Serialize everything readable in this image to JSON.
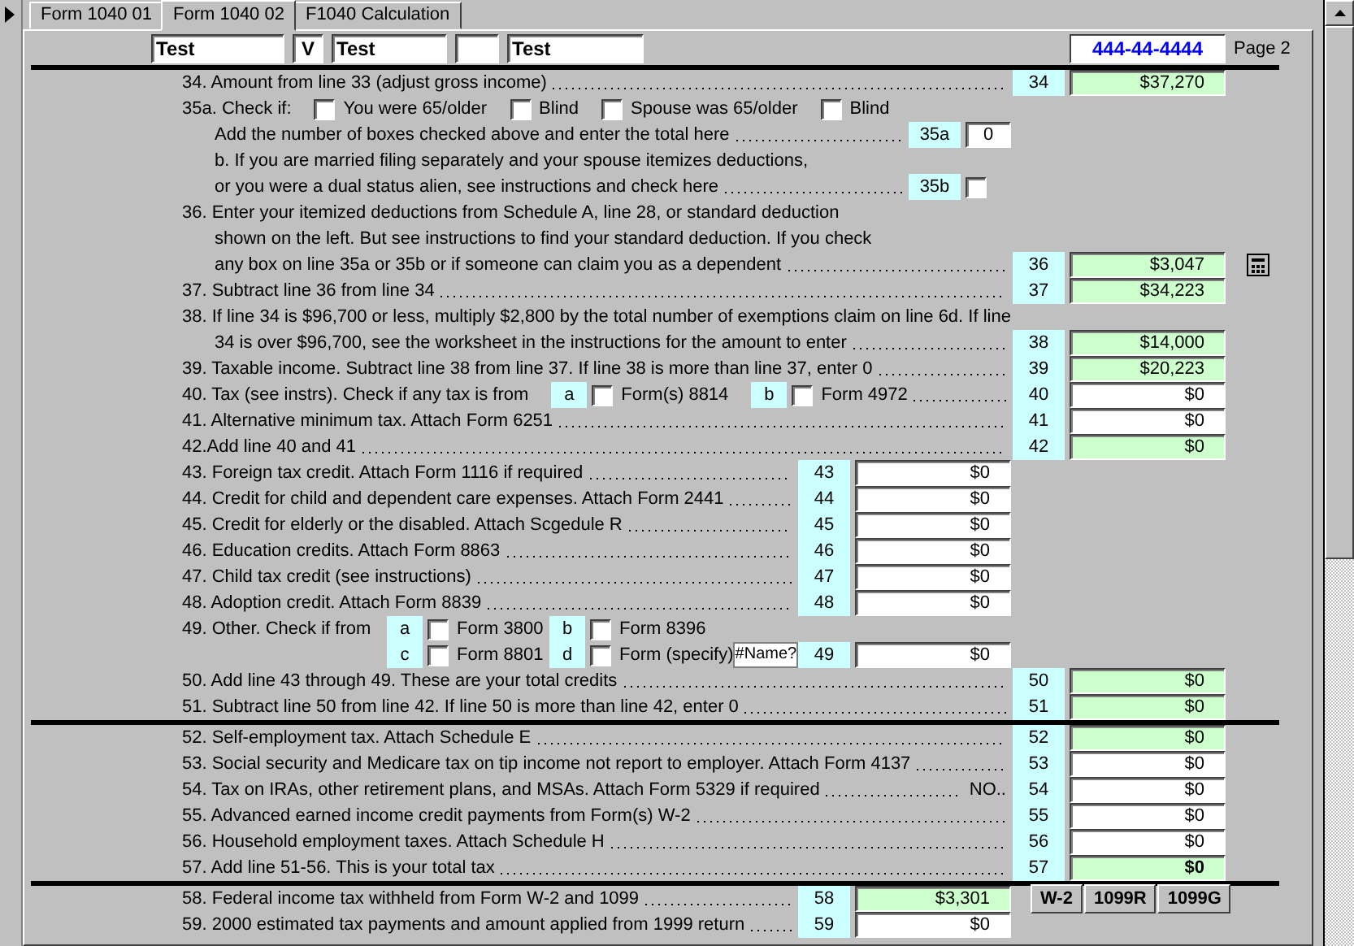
{
  "tabs": [
    {
      "label": "Form 1040 01",
      "selected": false
    },
    {
      "label": "Form 1040 02",
      "selected": true
    },
    {
      "label": "F1040 Calculation",
      "selected": false
    }
  ],
  "header": {
    "fields": [
      {
        "value": "Test"
      },
      {
        "value": "V"
      },
      {
        "value": "Test"
      },
      {
        "kind": "blank"
      },
      {
        "value": "Test"
      }
    ],
    "ssn": "444-44-4444",
    "page": "Page 2"
  },
  "sections": [
    {
      "rows": [
        {
          "kind": "line",
          "text": "34. Amount from line 33 (adjust gross income)",
          "leader": true,
          "entry": {
            "kind": "amount",
            "line": "34",
            "value": "$37,270",
            "computed": true
          }
        },
        {
          "kind": "line",
          "text": "35a. Check if:",
          "checks": [
            {
              "label": "You were 65/older",
              "checked": false
            },
            {
              "label": "Blind",
              "checked": false
            },
            {
              "label": "Spouse was 65/older",
              "checked": false
            },
            {
              "label": "Blind",
              "checked": false
            }
          ],
          "children": [
            {
              "kind": "line",
              "text": "Add the number of boxes checked above and enter the total here",
              "leader": true,
              "entry": {
                "kind": "count",
                "line": "35a",
                "value": "0"
              }
            },
            {
              "kind": "line",
              "text": "b. If you are married filing separately and your spouse itemizes deductions,"
            },
            {
              "kind": "line",
              "text": "or you were a dual status alien, see instructions and check here",
              "leader": true,
              "entry": {
                "kind": "checkbox",
                "line": "35b",
                "checked": false
              }
            }
          ]
        },
        {
          "kind": "line",
          "text": "36. Enter your itemized deductions from Schedule A, line 28, or standard deduction",
          "children": [
            {
              "kind": "line",
              "text": "shown on the left. But see instructions to find your standard deduction. If you check"
            },
            {
              "kind": "line",
              "text": "any box on line 35a or 35b  or if someone can claim you as a dependent",
              "leader": true,
              "calculator": true,
              "entry": {
                "kind": "amount",
                "line": "36",
                "value": "$3,047",
                "computed": true
              }
            }
          ]
        },
        {
          "kind": "line",
          "text": "37. Subtract line 36 from line 34",
          "leader": true,
          "entry": {
            "kind": "amount",
            "line": "37",
            "value": "$34,223",
            "computed": true
          }
        },
        {
          "kind": "line",
          "text": "38. If line 34 is $96,700 or less, multiply $2,800 by the total number of exemptions claim on line 6d. If line",
          "children": [
            {
              "kind": "line",
              "text": "34 is over $96,700, see the worksheet in the instructions for the amount to enter",
              "leader": true,
              "entry": {
                "kind": "amount",
                "line": "38",
                "value": "$14,000",
                "computed": true
              }
            }
          ]
        },
        {
          "kind": "line",
          "text": "39. Taxable income. Subtract line 38 from line 37. If line 38 is more than line 37, enter 0",
          "leader": true,
          "entry": {
            "kind": "amount",
            "line": "39",
            "value": "$20,223",
            "computed": true
          }
        },
        {
          "kind": "line",
          "text": "40. Tax (see instrs). Check if any tax is from",
          "checks": [
            {
              "tag": "a",
              "label": "Form(s) 8814",
              "checked": false
            },
            {
              "tag": "b",
              "label": "Form 4972",
              "checked": false
            }
          ],
          "leader": true,
          "entry": {
            "kind": "amount",
            "line": "40",
            "value": "$0",
            "computed": false
          }
        },
        {
          "kind": "line",
          "text": "41. Alternative minimum tax. Attach Form 6251",
          "leader": true,
          "entry": {
            "kind": "amount",
            "line": "41",
            "value": "$0",
            "computed": false
          }
        },
        {
          "kind": "line",
          "text": "42.Add line 40 and 41",
          "leader": true,
          "entry": {
            "kind": "amount",
            "line": "42",
            "value": "$0",
            "computed": true
          }
        },
        {
          "kind": "line",
          "text": "43. Foreign tax credit. Attach Form 1116 if required",
          "leader": true,
          "entry": {
            "kind": "subamount",
            "line": "43",
            "value": "$0",
            "computed": false
          }
        },
        {
          "kind": "line",
          "text": "44. Credit for child and dependent care expenses. Attach Form 2441",
          "leader": true,
          "entry": {
            "kind": "subamount",
            "line": "44",
            "value": "$0",
            "computed": false
          }
        },
        {
          "kind": "line",
          "text": "45. Credit for elderly or the disabled. Attach Scgedule R",
          "leader": true,
          "entry": {
            "kind": "subamount",
            "line": "45",
            "value": "$0",
            "computed": false
          }
        },
        {
          "kind": "line",
          "text": "46. Education credits. Attach Form 8863",
          "leader": true,
          "entry": {
            "kind": "subamount",
            "line": "46",
            "value": "$0",
            "computed": false
          }
        },
        {
          "kind": "line",
          "text": "47. Child tax credit (see instructions)",
          "leader": true,
          "entry": {
            "kind": "subamount",
            "line": "47",
            "value": "$0",
            "computed": false
          }
        },
        {
          "kind": "line",
          "text": "48. Adoption credit. Attach Form 8839",
          "leader": true,
          "entry": {
            "kind": "subamount",
            "line": "48",
            "value": "$0",
            "computed": false
          }
        },
        {
          "kind": "grid",
          "text": "49. Other. Check if from",
          "checks": [
            {
              "tag": "a",
              "label": "Form 3800",
              "checked": false
            },
            {
              "tag": "b",
              "label": "Form 8396",
              "checked": false
            }
          ]
        },
        {
          "kind": "grid",
          "checks": [
            {
              "tag": "c",
              "label": "Form 8801",
              "checked": false
            },
            {
              "tag": "d",
              "label": "Form (specify)",
              "checked": false
            }
          ],
          "specify": "#Name?",
          "entry": {
            "kind": "subamount",
            "line": "49",
            "value": "$0",
            "computed": false
          }
        },
        {
          "kind": "line",
          "text": "50. Add line 43 through 49. These are your total credits",
          "leader": true,
          "entry": {
            "kind": "amount",
            "line": "50",
            "value": "$0",
            "computed": true
          }
        },
        {
          "kind": "line",
          "text": "51. Subtract line 50 from line 42. If line 50 is more than line 42, enter 0",
          "leader": true,
          "entry": {
            "kind": "amount",
            "line": "51",
            "value": "$0",
            "computed": true
          }
        }
      ]
    },
    {
      "rows": [
        {
          "kind": "line",
          "text": "52. Self-employment tax. Attach Schedule E",
          "leader": true,
          "entry": {
            "kind": "amount",
            "line": "52",
            "value": "$0",
            "computed": true
          }
        },
        {
          "kind": "line",
          "text": "53. Social security and Medicare tax on tip income not report to employer. Attach Form 4137",
          "leader": true,
          "entry": {
            "kind": "amount",
            "line": "53",
            "value": "$0",
            "computed": false
          }
        },
        {
          "kind": "line",
          "text": "54. Tax on IRAs, other retirement plans, and MSAs. Attach Form 5329 if required",
          "leader": true,
          "suffix": "NO..",
          "entry": {
            "kind": "amount",
            "line": "54",
            "value": "$0",
            "computed": false
          }
        },
        {
          "kind": "line",
          "text": "55. Advanced earned income credit payments from Form(s) W-2",
          "leader": true,
          "entry": {
            "kind": "amount",
            "line": "55",
            "value": "$0",
            "computed": false
          }
        },
        {
          "kind": "line",
          "text": "56. Household employment taxes. Attach Schedule H",
          "leader": true,
          "entry": {
            "kind": "amount",
            "line": "56",
            "value": "$0",
            "computed": false
          }
        },
        {
          "kind": "line",
          "text": "57. Add line 51-56. This is your total tax",
          "leader": true,
          "entry": {
            "kind": "amount",
            "line": "57",
            "value": "$0",
            "computed": true,
            "total": true
          }
        }
      ]
    },
    {
      "rows": [
        {
          "kind": "line",
          "text": "58. Federal income tax withheld from Form W-2 and 1099",
          "leader": true,
          "buttons": [
            "W-2",
            "1099R",
            "1099G"
          ],
          "entry": {
            "kind": "subamount",
            "line": "58",
            "value": "$3,301",
            "computed": true
          }
        },
        {
          "kind": "line",
          "text": "59. 2000 estimated tax payments and amount applied from 1999 return",
          "leader": true,
          "entry": {
            "kind": "subamount",
            "line": "59",
            "value": "$0",
            "computed": false
          }
        }
      ]
    }
  ]
}
